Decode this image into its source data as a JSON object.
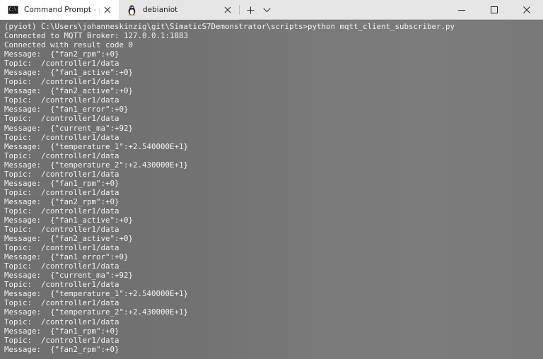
{
  "tabs": [
    {
      "label": "Command Prompt - python  mqtt_client_subscriber.py",
      "icon": "cmd-prompt-icon",
      "active": true
    },
    {
      "label": "debianiot",
      "icon": "linux-penguin-icon",
      "active": false
    }
  ],
  "cmd_icon_text": "C:\\",
  "terminal": {
    "foreground": "#f2f2f2",
    "lines": [
      "(pyiot) C:\\Users\\johanneskinzig\\git\\SimaticS7Demonstrator\\scripts>python mqtt_client_subscriber.py",
      "Connected to MQTT Broker: 127.0.0.1:1883",
      "Connected with result code 0",
      "Message:  {\"fan2_rpm\":+0}",
      "Topic:  /controller1/data",
      "Message:  {\"fan1_active\":+0}",
      "Topic:  /controller1/data",
      "Message:  {\"fan2_active\":+0}",
      "Topic:  /controller1/data",
      "Message:  {\"fan1_error\":+0}",
      "Topic:  /controller1/data",
      "Message:  {\"current_ma\":+92}",
      "Topic:  /controller1/data",
      "Message:  {\"temperature_1\":+2.540000E+1}",
      "Topic:  /controller1/data",
      "Message:  {\"temperature_2\":+2.430000E+1}",
      "Topic:  /controller1/data",
      "Message:  {\"fan1_rpm\":+0}",
      "Topic:  /controller1/data",
      "Message:  {\"fan2_rpm\":+0}",
      "Topic:  /controller1/data",
      "Message:  {\"fan1_active\":+0}",
      "Topic:  /controller1/data",
      "Message:  {\"fan2_active\":+0}",
      "Topic:  /controller1/data",
      "Message:  {\"fan1_error\":+0}",
      "Topic:  /controller1/data",
      "Message:  {\"current_ma\":+92}",
      "Topic:  /controller1/data",
      "Message:  {\"temperature_1\":+2.540000E+1}",
      "Topic:  /controller1/data",
      "Message:  {\"temperature_2\":+2.430000E+1}",
      "Topic:  /controller1/data",
      "Message:  {\"fan1_rpm\":+0}",
      "Topic:  /controller1/data",
      "Message:  {\"fan2_rpm\":+0}"
    ]
  }
}
